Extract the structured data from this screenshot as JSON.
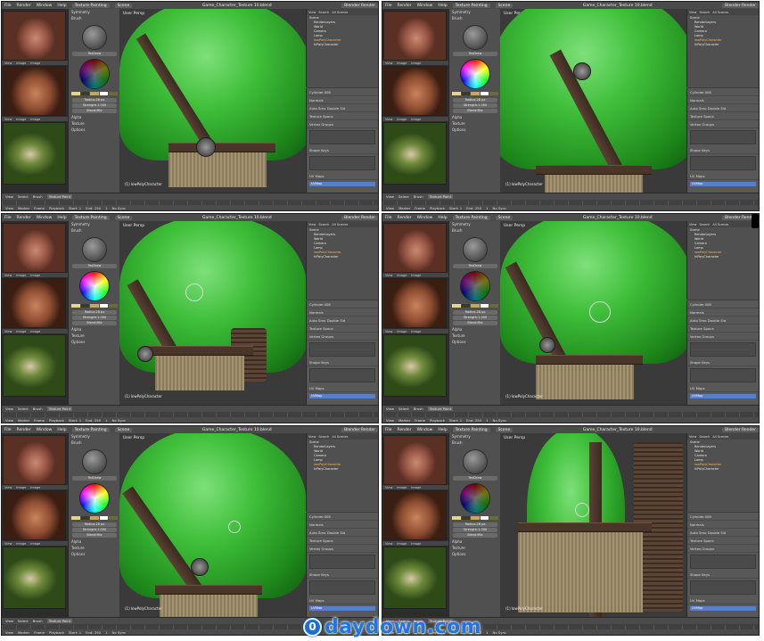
{
  "app": {
    "menu": [
      "File",
      "Render",
      "Window",
      "Help"
    ],
    "mode_dropdown": "Texture Painting",
    "scene_dropdown": "Scene",
    "engine_dropdown": "Blender Render",
    "filename": "Game_Character_Texture 10.blend"
  },
  "reference_panel": {
    "bar_items": [
      "View",
      "Image",
      "Image"
    ]
  },
  "tools": {
    "sections": [
      "Symmetry",
      "Brush"
    ],
    "brush_name": "TexDraw",
    "radius_label": "Radius:",
    "radius_value": "28 px",
    "strength_label": "Strength:",
    "strength_value": "1.000",
    "blend_label": "Blend:",
    "blend_value": "Mix",
    "texture_section": "Texture",
    "checkbox_alpha": "Alpha",
    "options": "Options"
  },
  "viewport": {
    "view_label": "User Persp",
    "object_label": "(1) lowPolyCharacter"
  },
  "outliner": {
    "header": [
      "View",
      "Search",
      "All Scenes"
    ],
    "items": [
      "Scene",
      "RenderLayers",
      "World",
      "Camera",
      "Lamp",
      "lowPolyCharacter",
      "hiPolyCharacter"
    ],
    "selected": "lowPolyCharacter"
  },
  "properties": {
    "sections": [
      "Normals",
      "Texture Space",
      "Vertex Groups",
      "Shape Keys",
      "UV Maps"
    ],
    "object_data": "Cylinder.008",
    "auto_smooth": "Auto Smo",
    "double_sided": "Double Sid",
    "uv_map": "UVMap"
  },
  "timeline": {
    "header_items": [
      "View",
      "Select",
      "Brush"
    ],
    "mode": "Texture Paint",
    "ctl_items": [
      "View",
      "Marker",
      "Frame",
      "Playback"
    ],
    "start_label": "Start: 1",
    "end_label": "End: 250",
    "current": "1",
    "sync": "No Sync"
  },
  "watermark": {
    "badge": "0",
    "text": "daydown.com"
  }
}
